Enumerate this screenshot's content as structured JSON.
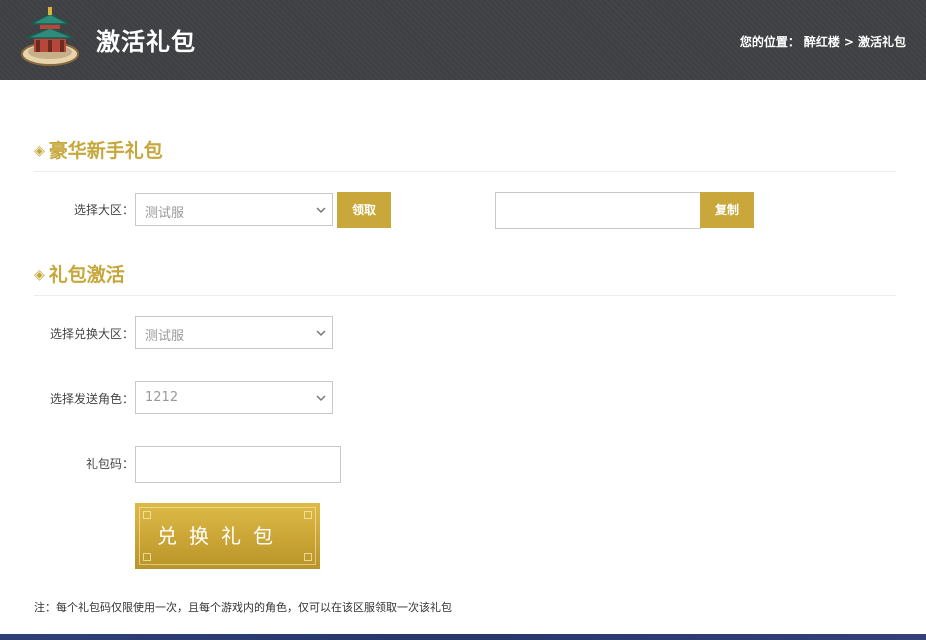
{
  "header": {
    "title": "激活礼包",
    "logo_icon": "pavilion-logo",
    "breadcrumb": {
      "prefix": "您的位置：",
      "home": "醉红楼",
      "separator": ">",
      "current": "激活礼包"
    }
  },
  "colors": {
    "accent": "#c9a73a",
    "header_bg": "#3e4043",
    "title": "#c6a73c"
  },
  "newbie_pack": {
    "title": "豪华新手礼包",
    "server_label": "选择大区：",
    "server_select": {
      "value": "测试服"
    },
    "claim_button": "领取",
    "code_field": {
      "value": ""
    },
    "copy_button": "复制"
  },
  "activation": {
    "title": "礼包激活",
    "server_label": "选择兑换大区：",
    "server_select": {
      "value": "测试服"
    },
    "role_label": "选择发送角色：",
    "role_select": {
      "value": "1212"
    },
    "code_label": "礼包码：",
    "code_input": {
      "value": ""
    },
    "redeem_button": "兑换礼包"
  },
  "note": "注：每个礼包码仅限使用一次，且每个游戏内的角色，仅可以在该区服领取一次该礼包"
}
